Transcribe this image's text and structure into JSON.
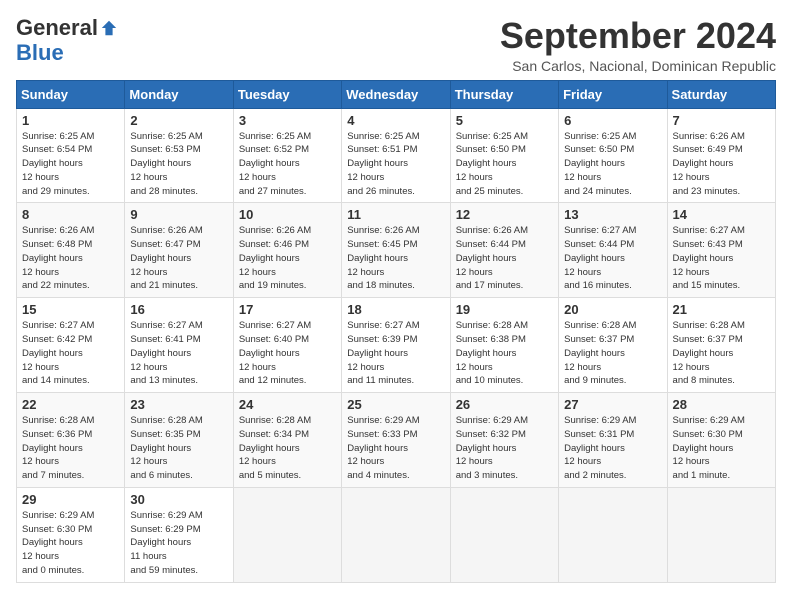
{
  "header": {
    "logo_general": "General",
    "logo_blue": "Blue",
    "month_title": "September 2024",
    "subtitle": "San Carlos, Nacional, Dominican Republic"
  },
  "weekdays": [
    "Sunday",
    "Monday",
    "Tuesday",
    "Wednesday",
    "Thursday",
    "Friday",
    "Saturday"
  ],
  "weeks": [
    [
      {
        "day": "1",
        "rise": "6:25 AM",
        "set": "6:54 PM",
        "hours": "12 hours",
        "mins": "and 29 minutes."
      },
      {
        "day": "2",
        "rise": "6:25 AM",
        "set": "6:53 PM",
        "hours": "12 hours",
        "mins": "and 28 minutes."
      },
      {
        "day": "3",
        "rise": "6:25 AM",
        "set": "6:52 PM",
        "hours": "12 hours",
        "mins": "and 27 minutes."
      },
      {
        "day": "4",
        "rise": "6:25 AM",
        "set": "6:51 PM",
        "hours": "12 hours",
        "mins": "and 26 minutes."
      },
      {
        "day": "5",
        "rise": "6:25 AM",
        "set": "6:50 PM",
        "hours": "12 hours",
        "mins": "and 25 minutes."
      },
      {
        "day": "6",
        "rise": "6:25 AM",
        "set": "6:50 PM",
        "hours": "12 hours",
        "mins": "and 24 minutes."
      },
      {
        "day": "7",
        "rise": "6:26 AM",
        "set": "6:49 PM",
        "hours": "12 hours",
        "mins": "and 23 minutes."
      }
    ],
    [
      {
        "day": "8",
        "rise": "6:26 AM",
        "set": "6:48 PM",
        "hours": "12 hours",
        "mins": "and 22 minutes."
      },
      {
        "day": "9",
        "rise": "6:26 AM",
        "set": "6:47 PM",
        "hours": "12 hours",
        "mins": "and 21 minutes."
      },
      {
        "day": "10",
        "rise": "6:26 AM",
        "set": "6:46 PM",
        "hours": "12 hours",
        "mins": "and 19 minutes."
      },
      {
        "day": "11",
        "rise": "6:26 AM",
        "set": "6:45 PM",
        "hours": "12 hours",
        "mins": "and 18 minutes."
      },
      {
        "day": "12",
        "rise": "6:26 AM",
        "set": "6:44 PM",
        "hours": "12 hours",
        "mins": "and 17 minutes."
      },
      {
        "day": "13",
        "rise": "6:27 AM",
        "set": "6:44 PM",
        "hours": "12 hours",
        "mins": "and 16 minutes."
      },
      {
        "day": "14",
        "rise": "6:27 AM",
        "set": "6:43 PM",
        "hours": "12 hours",
        "mins": "and 15 minutes."
      }
    ],
    [
      {
        "day": "15",
        "rise": "6:27 AM",
        "set": "6:42 PM",
        "hours": "12 hours",
        "mins": "and 14 minutes."
      },
      {
        "day": "16",
        "rise": "6:27 AM",
        "set": "6:41 PM",
        "hours": "12 hours",
        "mins": "and 13 minutes."
      },
      {
        "day": "17",
        "rise": "6:27 AM",
        "set": "6:40 PM",
        "hours": "12 hours",
        "mins": "and 12 minutes."
      },
      {
        "day": "18",
        "rise": "6:27 AM",
        "set": "6:39 PM",
        "hours": "12 hours",
        "mins": "and 11 minutes."
      },
      {
        "day": "19",
        "rise": "6:28 AM",
        "set": "6:38 PM",
        "hours": "12 hours",
        "mins": "and 10 minutes."
      },
      {
        "day": "20",
        "rise": "6:28 AM",
        "set": "6:37 PM",
        "hours": "12 hours",
        "mins": "and 9 minutes."
      },
      {
        "day": "21",
        "rise": "6:28 AM",
        "set": "6:37 PM",
        "hours": "12 hours",
        "mins": "and 8 minutes."
      }
    ],
    [
      {
        "day": "22",
        "rise": "6:28 AM",
        "set": "6:36 PM",
        "hours": "12 hours",
        "mins": "and 7 minutes."
      },
      {
        "day": "23",
        "rise": "6:28 AM",
        "set": "6:35 PM",
        "hours": "12 hours",
        "mins": "and 6 minutes."
      },
      {
        "day": "24",
        "rise": "6:28 AM",
        "set": "6:34 PM",
        "hours": "12 hours",
        "mins": "and 5 minutes."
      },
      {
        "day": "25",
        "rise": "6:29 AM",
        "set": "6:33 PM",
        "hours": "12 hours",
        "mins": "and 4 minutes."
      },
      {
        "day": "26",
        "rise": "6:29 AM",
        "set": "6:32 PM",
        "hours": "12 hours",
        "mins": "and 3 minutes."
      },
      {
        "day": "27",
        "rise": "6:29 AM",
        "set": "6:31 PM",
        "hours": "12 hours",
        "mins": "and 2 minutes."
      },
      {
        "day": "28",
        "rise": "6:29 AM",
        "set": "6:30 PM",
        "hours": "12 hours",
        "mins": "and 1 minute."
      }
    ],
    [
      {
        "day": "29",
        "rise": "6:29 AM",
        "set": "6:30 PM",
        "hours": "12 hours",
        "mins": "and 0 minutes."
      },
      {
        "day": "30",
        "rise": "6:29 AM",
        "set": "6:29 PM",
        "hours": "11 hours",
        "mins": "and 59 minutes."
      },
      null,
      null,
      null,
      null,
      null
    ]
  ],
  "labels": {
    "sunrise": "Sunrise:",
    "sunset": "Sunset:",
    "daylight": "Daylight hours"
  }
}
